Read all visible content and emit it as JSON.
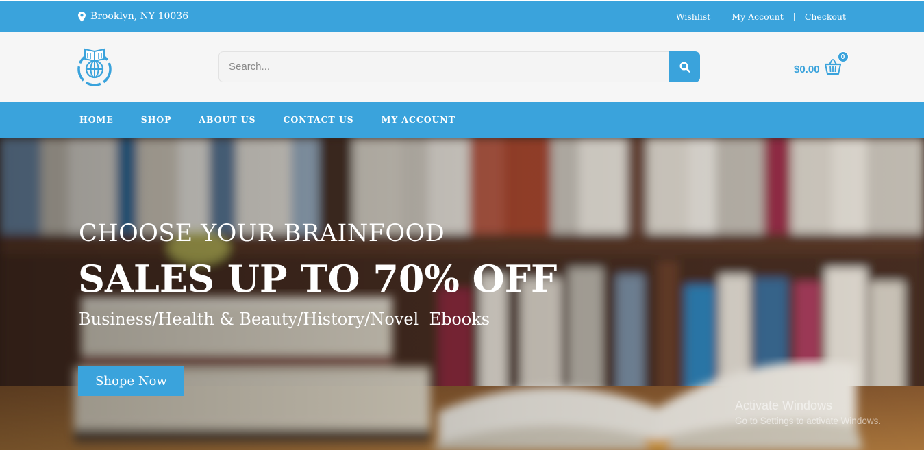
{
  "topbar": {
    "location": "Brooklyn, NY 10036",
    "links": [
      "Wishlist",
      "My Account",
      "Checkout"
    ],
    "icon": "map-pin-icon"
  },
  "header": {
    "logo_icon": "book-globe-logo-icon",
    "search_placeholder": "Search...",
    "search_icon": "search-icon",
    "cart_amount": "$0.00",
    "cart_count": "0",
    "cart_icon": "basket-icon"
  },
  "nav": {
    "items": [
      "HOME",
      "SHOP",
      "ABOUT US",
      "CONTACT US",
      "MY ACCOUNT"
    ]
  },
  "hero": {
    "eyebrow": "CHOOSE YOUR BRAINFOOD",
    "headline": "SALES UP TO 70% OFF",
    "subtitle": "Business/Health & Beauty/History/Novel  Ebooks",
    "cta": "Shope Now"
  },
  "watermark": {
    "line1": "Activate Windows",
    "line2": "Go to Settings to activate Windows."
  },
  "colors": {
    "accent": "#3aa3dc",
    "header_bg": "#f6f6f6"
  }
}
